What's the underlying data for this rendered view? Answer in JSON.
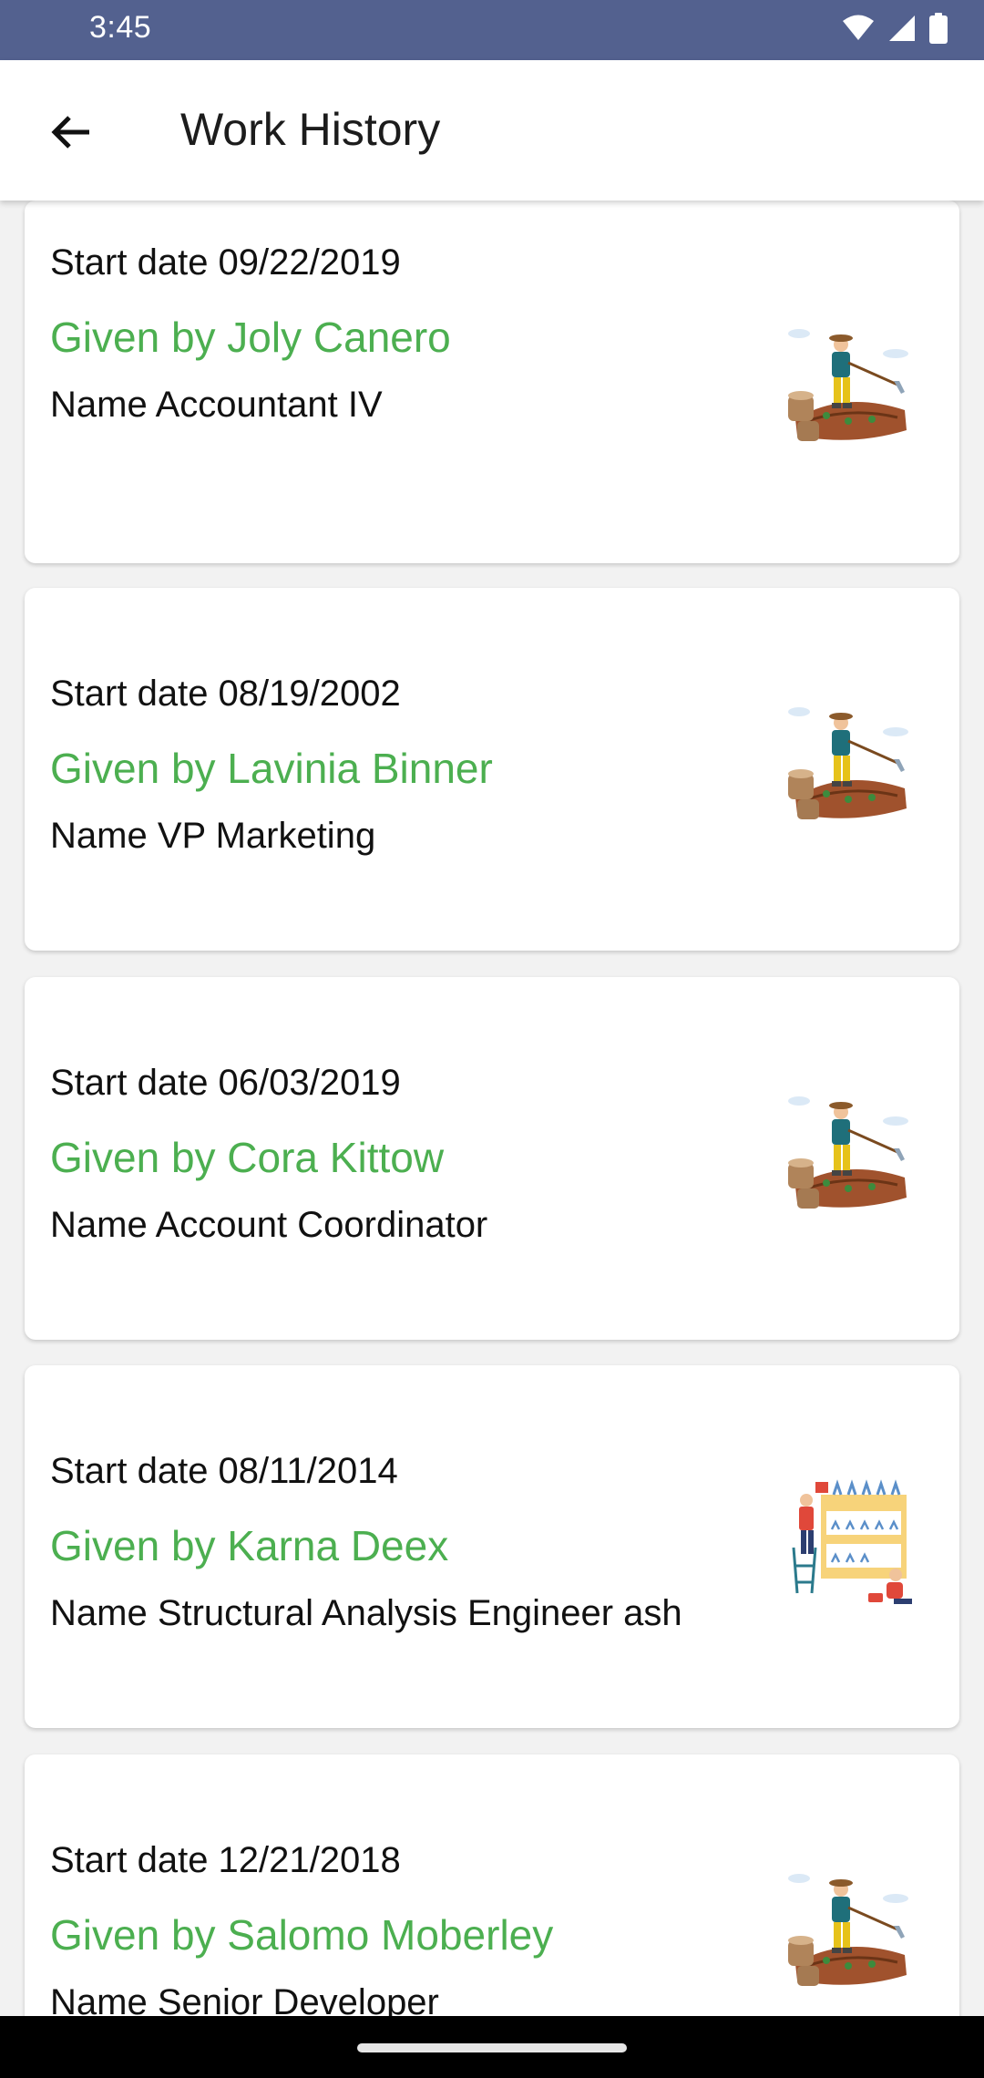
{
  "status_bar": {
    "time": "3:45",
    "icons": [
      "wifi-icon",
      "signal-icon",
      "battery-icon"
    ]
  },
  "app_bar": {
    "back_icon": "arrow-left-icon",
    "title": "Work History"
  },
  "colors": {
    "status_bar": "#53618f",
    "accent_green": "#4caf50",
    "card_background": "#ffffff",
    "page_background": "#f2f2f2"
  },
  "cards": [
    {
      "start_date": "Start date 09/22/2019",
      "given_by": "Given by Joly Canero",
      "name": "Name Accountant IV",
      "illustration": "farmer-illustration"
    },
    {
      "start_date": "Start date 08/19/2002",
      "given_by": "Given by Lavinia Binner",
      "name": "Name VP Marketing",
      "illustration": "farmer-illustration"
    },
    {
      "start_date": "Start date 06/03/2019",
      "given_by": "Given by Cora Kittow",
      "name": "Name Account Coordinator",
      "illustration": "farmer-illustration"
    },
    {
      "start_date": "Start date 08/11/2014",
      "given_by": "Given by Karna Deex",
      "name": "Name Structural Analysis Engineer ash",
      "illustration": "greenhouse-illustration"
    },
    {
      "start_date": "Start date 12/21/2018",
      "given_by": "Given by Salomo Moberley",
      "name": "Name Senior Developer",
      "illustration": "farmer-illustration"
    }
  ]
}
